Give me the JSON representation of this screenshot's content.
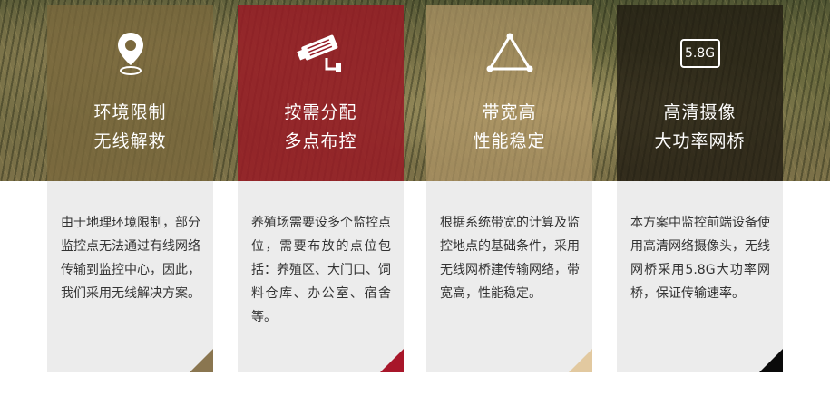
{
  "cards": [
    {
      "icon": "location-pin-icon",
      "title_line1": "环境限制",
      "title_line2": "无线解救",
      "text": "由于地理环境限制，部分监控点无法通过有线网络传输到监控中心，因此，我们采用无线解决方案。",
      "top_color": "rgba(122,104,60,0.78)",
      "corner_color": "#8a7650"
    },
    {
      "icon": "security-camera-icon",
      "title_line1": "按需分配",
      "title_line2": "多点布控",
      "text": "养殖场需要设多个监控点位，需要布放的点位包括：养殖区、大门口、饲料仓库、办公室、宿舍等。",
      "top_color": "rgba(150,28,38,0.88)",
      "corner_color": "#a8162a"
    },
    {
      "icon": "triangle-network-icon",
      "title_line1": "带宽高",
      "title_line2": "性能稳定",
      "text": "根据系统带宽的计算及监控地点的基础条件，采用无线网桥建传输网络，带宽高，性能稳定。",
      "top_color": "rgba(176,150,102,0.72)",
      "corner_color": "#e2c9a0"
    },
    {
      "icon": "5.8g-badge-icon",
      "badge_text": "5.8G",
      "title_line1": "高清摄像",
      "title_line2": "大功率网桥",
      "text": "本方案中监控前端设备使用高清网络摄像头，无线网桥采用5.8G大功率网桥，保证传输速率。",
      "top_color": "rgba(32,28,18,0.80)",
      "corner_color": "#0a0a0a"
    }
  ]
}
